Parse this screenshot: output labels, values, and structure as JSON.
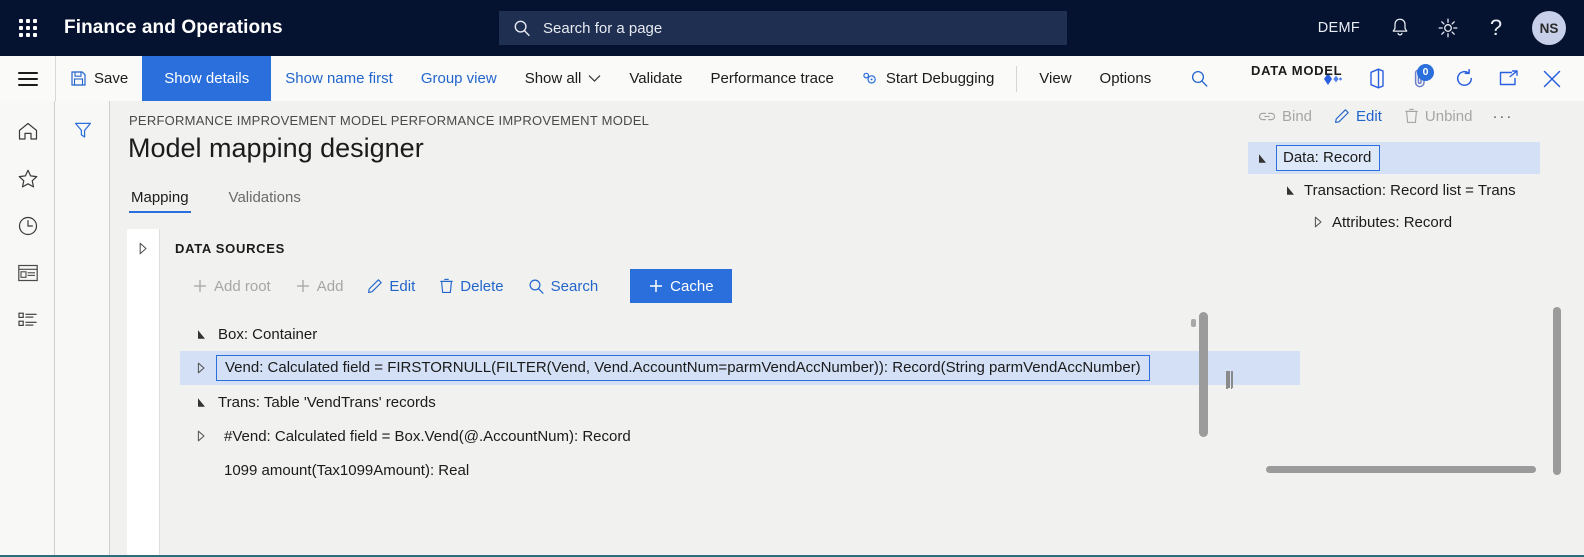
{
  "topbar": {
    "waffle_label": "app-launcher",
    "app_title": "Finance and Operations",
    "search": {
      "placeholder": "Search for a page",
      "value": "",
      "icon": "search-icon"
    },
    "company_code": "DEMF",
    "icons": [
      {
        "name": "notifications-icon",
        "glyph": "bell"
      },
      {
        "name": "settings-icon",
        "glyph": "gear"
      },
      {
        "name": "help-icon",
        "glyph": "question"
      }
    ],
    "avatar_initials": "NS"
  },
  "action_pane": {
    "menu_icon": "hamburger-icon",
    "buttons": [
      {
        "name": "save-button",
        "label": "Save",
        "icon": "save-icon",
        "style": "default"
      },
      {
        "name": "show-details-tab",
        "label": "Show details",
        "style": "primary"
      },
      {
        "name": "show-name-first-button",
        "label": "Show name first",
        "style": "link"
      },
      {
        "name": "group-view-button",
        "label": "Group view",
        "style": "link"
      },
      {
        "name": "show-all-button",
        "label": "Show all",
        "style": "default",
        "caret": true
      },
      {
        "name": "validate-button",
        "label": "Validate",
        "style": "default"
      },
      {
        "name": "performance-trace-button",
        "label": "Performance trace",
        "style": "default"
      },
      {
        "name": "start-debugging-button",
        "label": "Start Debugging",
        "icon": "debug-icon",
        "style": "default"
      },
      {
        "name": "view-menu",
        "label": "View",
        "style": "default"
      },
      {
        "name": "options-menu",
        "label": "Options",
        "style": "default"
      }
    ],
    "right_icons": [
      {
        "name": "page-search-icon",
        "glyph": "magnifier"
      },
      {
        "name": "diamonds-icon",
        "glyph": "diamonds"
      },
      {
        "name": "office-app-icon",
        "glyph": "office"
      },
      {
        "name": "attachments-icon",
        "glyph": "paperclip",
        "badge": "0"
      },
      {
        "name": "refresh-icon",
        "glyph": "refresh"
      },
      {
        "name": "popout-icon",
        "glyph": "popout"
      },
      {
        "name": "close-icon",
        "glyph": "close"
      }
    ]
  },
  "nav_rail": {
    "items": [
      {
        "name": "nav-home",
        "icon": "home-icon"
      },
      {
        "name": "nav-favorites",
        "icon": "star-icon"
      },
      {
        "name": "nav-recent",
        "icon": "clock-icon"
      },
      {
        "name": "nav-workspaces",
        "icon": "workspace-icon"
      },
      {
        "name": "nav-modules",
        "icon": "list-icon"
      }
    ],
    "filter_icon": "filter-icon"
  },
  "page": {
    "breadcrumb": "PERFORMANCE IMPROVEMENT MODEL PERFORMANCE IMPROVEMENT MODEL",
    "title": "Model mapping designer",
    "tabs": [
      {
        "name": "tab-mapping",
        "label": "Mapping",
        "active": true
      },
      {
        "name": "tab-validations",
        "label": "Validations",
        "active": false
      }
    ]
  },
  "data_sources": {
    "heading": "DATA SOURCES",
    "collapse_icon": "chevron-right-icon",
    "toolbar": [
      {
        "name": "add-root-button",
        "label": "Add root",
        "icon": "plus-icon",
        "disabled": true
      },
      {
        "name": "add-button",
        "label": "Add",
        "icon": "plus-icon",
        "disabled": true
      },
      {
        "name": "edit-button",
        "label": "Edit",
        "icon": "pencil-icon",
        "disabled": false
      },
      {
        "name": "delete-button",
        "label": "Delete",
        "icon": "trash-icon",
        "disabled": false
      },
      {
        "name": "search-button",
        "label": "Search",
        "icon": "magnifier-icon",
        "disabled": false
      },
      {
        "name": "cache-button",
        "label": "Cache",
        "icon": "plus-icon",
        "primary": true
      }
    ],
    "tree": [
      {
        "label": "Box: Container",
        "level": 1,
        "twisty": "expanded",
        "selected": false
      },
      {
        "label": "Vend: Calculated field = FIRSTORNULL(FILTER(Vend, Vend.AccountNum=parmVendAccNumber)): Record(String parmVendAccNumber)",
        "level": 2,
        "twisty": "collapsed",
        "selected": true
      },
      {
        "label": "Trans: Table 'VendTrans' records",
        "level": 1,
        "twisty": "expanded",
        "selected": false
      },
      {
        "label": "#Vend: Calculated field = Box.Vend(@.AccountNum): Record",
        "level": 2,
        "twisty": "collapsed",
        "selected": false
      },
      {
        "label": "1099 amount(Tax1099Amount): Real",
        "level": 3,
        "twisty": "none",
        "selected": false
      }
    ]
  },
  "data_model": {
    "heading": "DATA MODEL",
    "toolbar": [
      {
        "name": "bind-button",
        "label": "Bind",
        "icon": "link-icon",
        "disabled": true
      },
      {
        "name": "edit-button",
        "label": "Edit",
        "icon": "pencil-icon",
        "disabled": false
      },
      {
        "name": "unbind-button",
        "label": "Unbind",
        "icon": "trash-icon",
        "disabled": true
      },
      {
        "name": "more-options-button",
        "label": "···",
        "icon": "ellipsis-icon",
        "disabled": false
      }
    ],
    "tree": [
      {
        "label": "Data: Record",
        "level": 1,
        "twisty": "expanded",
        "selected": true
      },
      {
        "label": "Transaction: Record list = Trans",
        "level": 2,
        "twisty": "expanded",
        "selected": false
      },
      {
        "label": "Attributes: Record",
        "level": 3,
        "twisty": "collapsed",
        "selected": false
      }
    ]
  },
  "colors": {
    "nav_bg": "#061330",
    "accent": "#2a6fdb",
    "link": "#2266cc",
    "selection": "#d3e0f5",
    "content_bg": "#f1f1ef",
    "chrome_bg": "#fafaf9"
  }
}
